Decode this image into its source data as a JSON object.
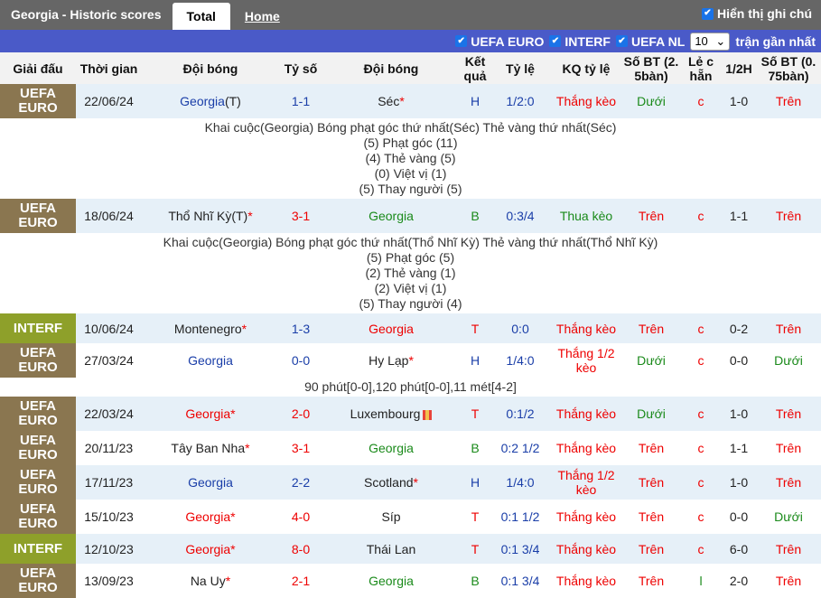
{
  "header": {
    "title": "Georgia - Historic scores",
    "tab_total": "Total",
    "tab_home": "Home",
    "show_note": "Hiển thị ghi chú"
  },
  "filters": {
    "f1": "UEFA EURO",
    "f2": "INTERF",
    "f3": "UEFA NL",
    "count": "10",
    "count_label": "trận gần nhất"
  },
  "columns": {
    "league": "Giải đấu",
    "time": "Thời gian",
    "home": "Đội bóng",
    "score": "Tỷ số",
    "away": "Đội bóng",
    "result": "Kết quả",
    "odds": "Tỷ lệ",
    "odds_result": "KQ tỷ lệ",
    "goals": "Số BT (2. 5bàn)",
    "oddeven": "Lẻ c hẵn",
    "half": "1/2H",
    "goals2": "Số BT (0. 75bàn)"
  },
  "matches": [
    {
      "league": "UEFA EURO",
      "date": "22/06/24",
      "home": "Georgia",
      "home_suffix": "(T)",
      "home_star": "",
      "score": "1-1",
      "away": "Séc",
      "away_star": "*",
      "res": "H",
      "odds": "1/2:0",
      "odds_res": "Thắng kèo",
      "ou": "Dưới",
      "oe": "c",
      "half": "1-0",
      "ou2": "Trên"
    },
    {
      "league": "UEFA EURO",
      "date": "18/06/24",
      "home": "Thổ Nhĩ Kỳ",
      "home_suffix": "(T)",
      "home_star": "*",
      "score": "3-1",
      "away": "Georgia",
      "away_star": "",
      "res": "B",
      "odds": "0:3/4",
      "odds_res": "Thua kèo",
      "ou": "Trên",
      "oe": "c",
      "half": "1-1",
      "ou2": "Trên"
    },
    {
      "league": "INTERF",
      "date": "10/06/24",
      "home": "Montenegro",
      "home_star": "*",
      "score": "1-3",
      "away": "Georgia",
      "away_star": "",
      "res": "T",
      "odds": "0:0",
      "odds_res": "Thắng kèo",
      "ou": "Trên",
      "oe": "c",
      "half": "0-2",
      "ou2": "Trên"
    },
    {
      "league": "UEFA EURO",
      "date": "27/03/24",
      "home": "Georgia",
      "home_star": "",
      "score": "0-0",
      "away": "Hy Lạp",
      "away_star": "*",
      "res": "H",
      "odds": "1/4:0",
      "odds_res": "Thắng 1/2 kèo",
      "ou": "Dưới",
      "oe": "c",
      "half": "0-0",
      "ou2": "Dưới"
    },
    {
      "league": "UEFA EURO",
      "date": "22/03/24",
      "home": "Georgia",
      "home_star": "*",
      "score": "2-0",
      "away": "Luxembourg",
      "away_star": "",
      "res": "T",
      "odds": "0:1/2",
      "odds_res": "Thắng kèo",
      "ou": "Dưới",
      "oe": "c",
      "half": "1-0",
      "ou2": "Trên"
    },
    {
      "league": "UEFA EURO",
      "date": "20/11/23",
      "home": "Tây Ban Nha",
      "home_star": "*",
      "score": "3-1",
      "away": "Georgia",
      "away_star": "",
      "res": "B",
      "odds": "0:2 1/2",
      "odds_res": "Thắng kèo",
      "ou": "Trên",
      "oe": "c",
      "half": "1-1",
      "ou2": "Trên"
    },
    {
      "league": "UEFA EURO",
      "date": "17/11/23",
      "home": "Georgia",
      "home_star": "",
      "score": "2-2",
      "away": "Scotland",
      "away_star": "*",
      "res": "H",
      "odds": "1/4:0",
      "odds_res": "Thắng 1/2 kèo",
      "ou": "Trên",
      "oe": "c",
      "half": "1-0",
      "ou2": "Trên"
    },
    {
      "league": "UEFA EURO",
      "date": "15/10/23",
      "home": "Georgia",
      "home_star": "*",
      "score": "4-0",
      "away": "Síp",
      "away_star": "",
      "res": "T",
      "odds": "0:1 1/2",
      "odds_res": "Thắng kèo",
      "ou": "Trên",
      "oe": "c",
      "half": "0-0",
      "ou2": "Dưới"
    },
    {
      "league": "INTERF",
      "date": "12/10/23",
      "home": "Georgia",
      "home_star": "*",
      "score": "8-0",
      "away": "Thái Lan",
      "away_star": "",
      "res": "T",
      "odds": "0:1 3/4",
      "odds_res": "Thắng kèo",
      "ou": "Trên",
      "oe": "c",
      "half": "6-0",
      "ou2": "Trên"
    },
    {
      "league": "UEFA EURO",
      "date": "13/09/23",
      "home": "Na Uy",
      "home_star": "*",
      "score": "2-1",
      "away": "Georgia",
      "away_star": "",
      "res": "B",
      "odds": "0:1 3/4",
      "odds_res": "Thắng kèo",
      "ou": "Trên",
      "oe": "l",
      "half": "2-0",
      "ou2": "Trên"
    }
  ],
  "details": {
    "d1": [
      "Khai cuộc(Georgia)   Bóng phạt góc thứ nhất(Séc)   Thẻ vàng thứ nhất(Séc)",
      "(5) Phạt góc (11)",
      "(4) Thẻ vàng (5)",
      "(0) Việt vị (1)",
      "(5) Thay người (5)"
    ],
    "d2": [
      "Khai cuộc(Georgia)   Bóng phạt góc thứ nhất(Thổ Nhĩ Kỳ)   Thẻ vàng thứ nhất(Thổ Nhĩ Kỳ)",
      "(5) Phạt góc (5)",
      "(2) Thẻ vàng (1)",
      "(2) Việt vị (1)",
      "(5) Thay người (4)"
    ],
    "d3": [
      "90 phút[0-0],120 phút[0-0],11 mét[4-2]"
    ]
  },
  "colors": {
    "header": "#666666",
    "filterbar": "#4a5ac8",
    "euro": "#8a7650",
    "interf": "#8ea02a",
    "row_alt": "#e6f0f8",
    "red": "#ee0000",
    "blue": "#1a3ea8",
    "green": "#1a8a1a"
  }
}
